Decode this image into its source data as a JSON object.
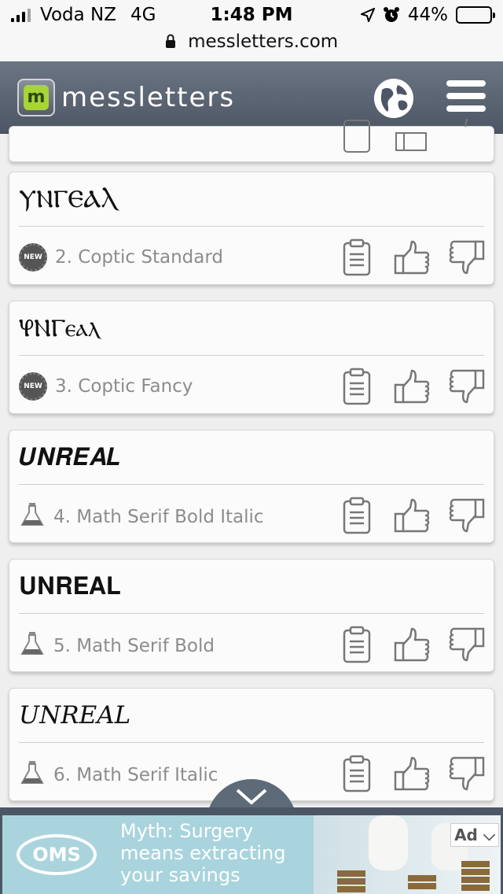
{
  "status_bar": {
    "carrier": "Voda NZ",
    "network": "4G",
    "time": "1:48 PM",
    "battery": "44%",
    "battery_level": 0.44
  },
  "url_bar": {
    "domain": "messletters.com"
  },
  "header": {
    "logo_text": "messletters",
    "logo_letter": "m"
  },
  "fonts": [
    {
      "sample": "ⲨⲚⲄⲈⲀⲖ",
      "label": "2. Coptic Standard",
      "badge": "NEW"
    },
    {
      "sample": "ⳠⲚⲄⲉⲁⲗ",
      "label": "3. Coptic Fancy",
      "badge": "NEW"
    },
    {
      "sample": "𝑼𝑵𝑹𝑬𝑨𝑳",
      "label": "4. Math Serif Bold Italic",
      "badge": "flask"
    },
    {
      "sample": "𝐔𝐍𝐑𝐄𝐀𝐋",
      "label": "5. Math Serif Bold",
      "badge": "flask"
    },
    {
      "sample": "𝑈𝑁𝑅𝐸𝐴𝐿",
      "label": "6. Math Serif Italic",
      "badge": "flask"
    }
  ],
  "ad": {
    "brand": "OMS",
    "headline": "Myth: Surgery means extracting your savings",
    "label": "Ad"
  },
  "colors": {
    "header": "#5a6371",
    "accent": "#a7d437",
    "ad_bg": "#a9d4dd"
  }
}
